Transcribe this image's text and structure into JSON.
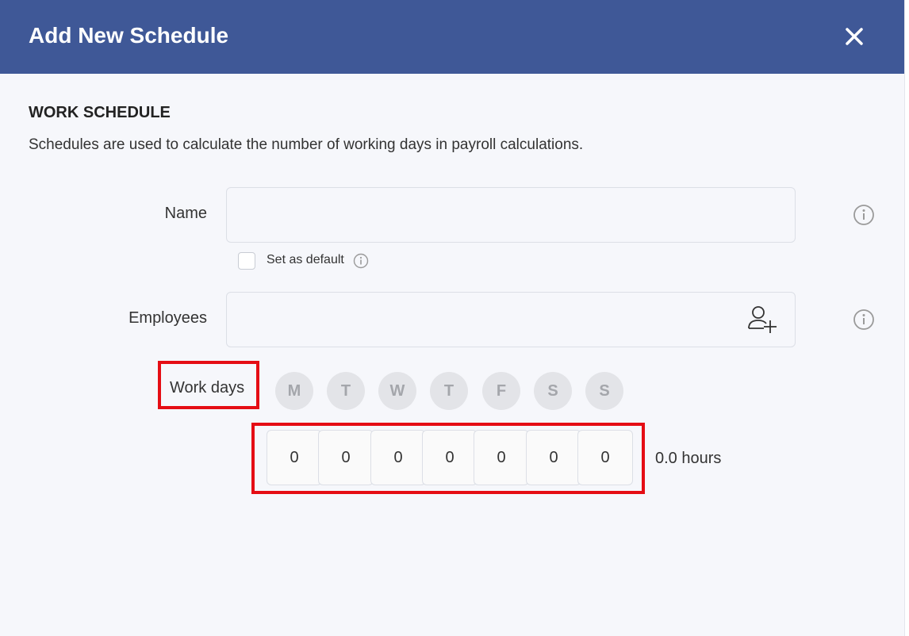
{
  "header": {
    "title": "Add New Schedule",
    "close_icon": "close-icon"
  },
  "section": {
    "title": "WORK SCHEDULE",
    "description": "Schedules are used to calculate the number of working days in payroll calculations."
  },
  "form": {
    "name_label": "Name",
    "name_value": "",
    "default_checkbox_label": "Set as default",
    "default_checked": false,
    "employees_label": "Employees",
    "employees_value": "",
    "work_days_label": "Work days",
    "days": [
      "M",
      "T",
      "W",
      "T",
      "F",
      "S",
      "S"
    ],
    "hours": [
      "0",
      "0",
      "0",
      "0",
      "0",
      "0",
      "0"
    ],
    "hours_total": "0.0 hours"
  },
  "colors": {
    "header_bg": "#3f5897",
    "highlight": "#e50d14",
    "day_inactive_bg": "#e3e4e8"
  }
}
